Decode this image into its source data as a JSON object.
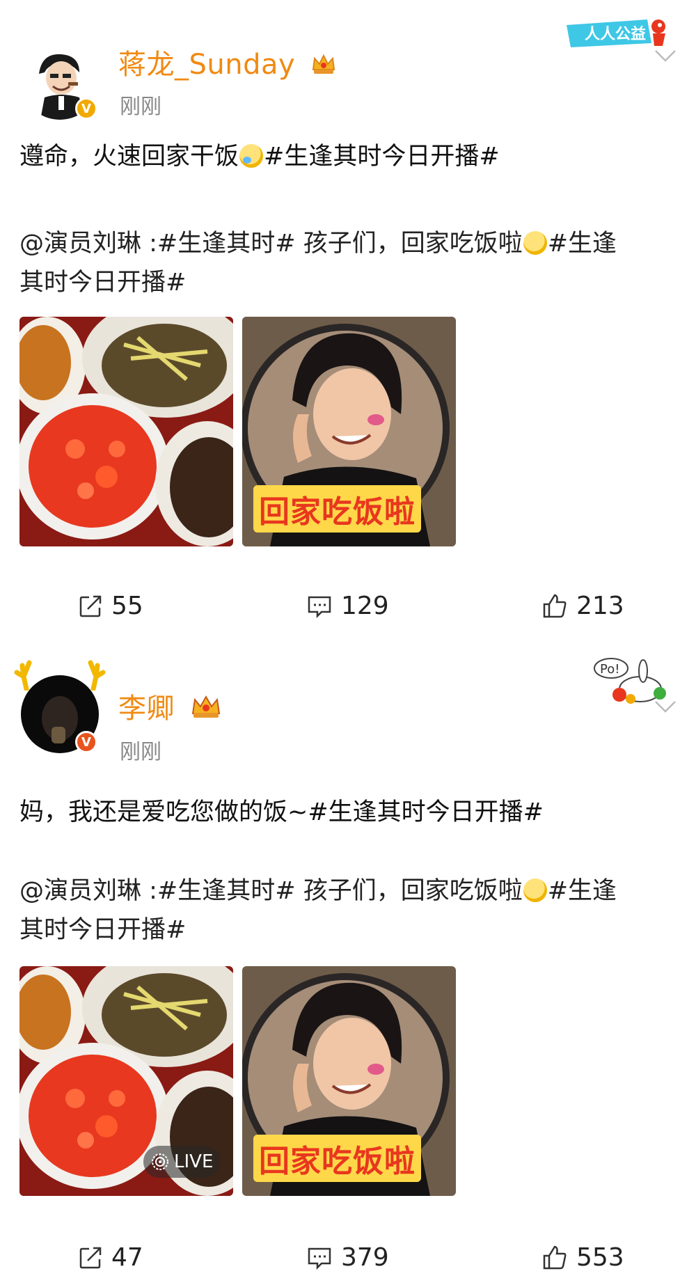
{
  "posts": [
    {
      "username": "蒋龙_Sunday",
      "time": "刚刚",
      "sticker_text": "人人公益",
      "content": "遵命，火速回家干饭",
      "content_tag": "#生逢其时今日开播#",
      "repost_line1": "@演员刘琳 :#生逢其时# 孩子们，回家吃饭啦",
      "repost_line1_tail": "#生逢",
      "repost_line2": "其时今日开播#",
      "image_caption": "回家吃饭啦",
      "live_label": "",
      "shares": "55",
      "comments": "129",
      "likes": "213"
    },
    {
      "username": "李卿",
      "time": "刚刚",
      "sticker_text": "Po!",
      "content": "妈，我还是爱吃您做的饭~",
      "content_tag": "#生逢其时今日开播#",
      "repost_line1": "@演员刘琳 :#生逢其时# 孩子们，回家吃饭啦",
      "repost_line1_tail": "#生逢",
      "repost_line2": "其时今日开播#",
      "image_caption": "回家吃饭啦",
      "live_label": "LIVE",
      "shares": "47",
      "comments": "379",
      "likes": "553"
    }
  ],
  "colors": {
    "username": "#f08a12",
    "time": "#888888",
    "text": "#111111",
    "caption_red": "#e8371e",
    "caption_bg": "#ffd84a"
  },
  "icons": [
    "share-icon",
    "comment-icon",
    "like-icon",
    "chevron-down-icon",
    "crown-icon",
    "verified-icon"
  ]
}
